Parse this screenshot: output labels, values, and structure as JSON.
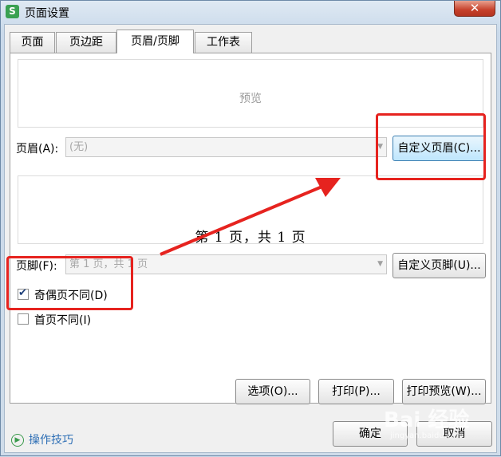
{
  "window": {
    "title": "页面设置",
    "icon_letter": "S",
    "close_label": "✕"
  },
  "tabs": [
    {
      "label": "页面"
    },
    {
      "label": "页边距"
    },
    {
      "label": "页眉/页脚"
    },
    {
      "label": "工作表"
    }
  ],
  "header": {
    "preview_label": "预览",
    "label": "页眉(A):",
    "value": "(无)",
    "custom_button": "自定义页眉(C)..."
  },
  "footer": {
    "preview_text": "第 1 页，共 1 页",
    "label": "页脚(F):",
    "value": "第 1 页，共 1 页",
    "custom_button": "自定义页脚(U)..."
  },
  "options": {
    "odd_even": {
      "label": "奇偶页不同(D)",
      "checked": true
    },
    "first_page": {
      "label": "首页不同(I)",
      "checked": false
    }
  },
  "panel_buttons": {
    "options": "选项(O)...",
    "print": "打印(P)...",
    "print_preview": "打印预览(W)..."
  },
  "dialog_buttons": {
    "ok": "确定",
    "cancel": "取消"
  },
  "tips": {
    "label": "操作技巧"
  },
  "watermark": {
    "text": "Bai 经验",
    "sub": "jingyan.baidu.com"
  },
  "annotation_color": "#e6231f"
}
